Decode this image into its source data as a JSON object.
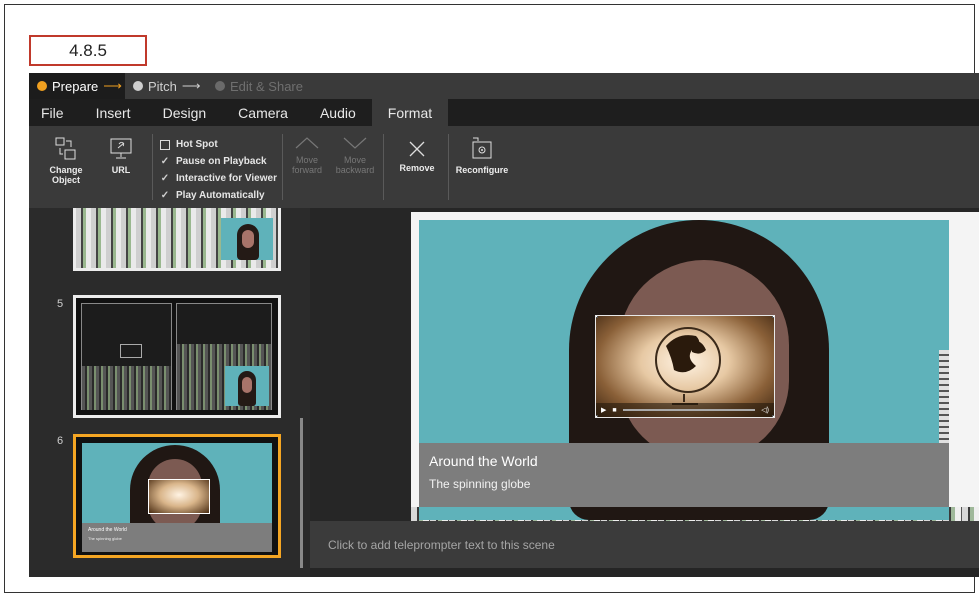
{
  "version_label": "4.8.5",
  "steps": [
    {
      "label": "Prepare",
      "arrow": "⟶"
    },
    {
      "label": "Pitch",
      "arrow": "⟶"
    },
    {
      "label": "Edit & Share"
    }
  ],
  "menu": [
    "File",
    "Insert",
    "Design",
    "Camera",
    "Audio",
    "Format"
  ],
  "ribbon": {
    "change_object": "Change Object",
    "url": "URL",
    "options": [
      {
        "label": "Hot Spot",
        "checked": false
      },
      {
        "label": "Pause on Playback",
        "checked": true
      },
      {
        "label": "Interactive for Viewer",
        "checked": true
      },
      {
        "label": "Play Automatically",
        "checked": true
      }
    ],
    "move_forward": "Move forward",
    "move_backward": "Move backward",
    "remove": "Remove",
    "reconfigure": "Reconfigure"
  },
  "scenes": [
    {
      "number": ""
    },
    {
      "number": "5"
    },
    {
      "number": "6",
      "caption_title": "Around the World",
      "caption_sub": "The spinning globe"
    }
  ],
  "caption": {
    "title": "Around the World",
    "subtitle": "The spinning globe"
  },
  "teleprompter_placeholder": "Click to add teleprompter text to this scene",
  "colors": {
    "accent": "#f5a623",
    "version_border": "#c0392b",
    "video_bg": "#5fb2ba"
  }
}
